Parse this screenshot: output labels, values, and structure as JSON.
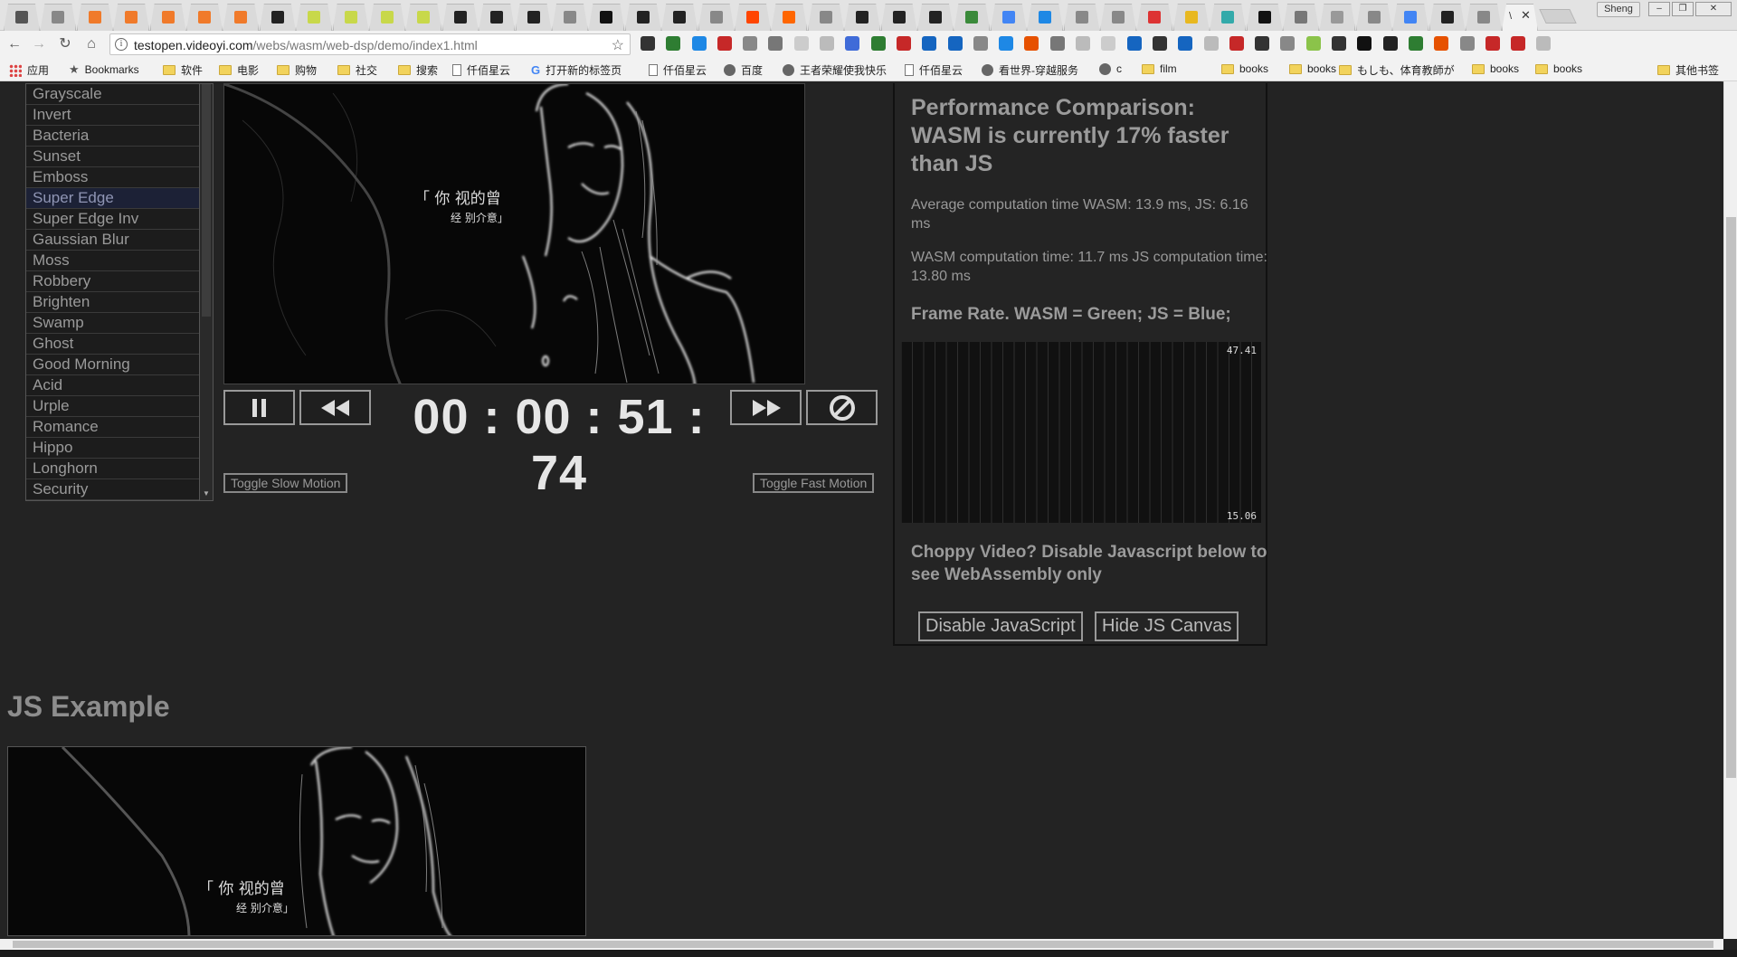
{
  "browser": {
    "profile_name": "Sheng",
    "active_tab_title": "\\",
    "tab_close": "✕",
    "url_host": "testopen.videoyi.com",
    "url_path": "/webs/wasm/web-dsp/demo/index1.html",
    "tab_favicon_colors": [
      "#555",
      "#888",
      "#f07a2a",
      "#f07a2a",
      "#f07a2a",
      "#f07a2a",
      "#f07a2a",
      "#222",
      "#c8d84a",
      "#c8d84a",
      "#c8d84a",
      "#c8d84a",
      "#222",
      "#222",
      "#222",
      "#888",
      "#111",
      "#222",
      "#222",
      "#888",
      "#ff4500",
      "#f60",
      "#888",
      "#222",
      "#222",
      "#222",
      "#3a8a3a",
      "#4285f4",
      "#1e88e5",
      "#888",
      "#888",
      "#d33",
      "#e8b820",
      "#3aa",
      "#111",
      "#777",
      "#999",
      "#888",
      "#4285f4",
      "#222",
      "#888"
    ],
    "ext_icon_colors": [
      "#333",
      "#2e7d32",
      "#1e88e5",
      "#c62828",
      "#888",
      "#777",
      "#ccc",
      "#bbb",
      "#3f6bd8",
      "#2e7d32",
      "#c62828",
      "#1565c0",
      "#1565c0",
      "#888",
      "#1e88e5",
      "#e65100",
      "#777",
      "#bbb",
      "#ccc",
      "#1565c0",
      "#333",
      "#1565c0",
      "#bbb",
      "#c62828",
      "#333",
      "#888",
      "#8bc34a",
      "#333",
      "#111",
      "#222",
      "#2e7d32",
      "#e65100",
      "#888",
      "#c62828",
      "#c62828",
      "#bbb"
    ]
  },
  "bookmarks": [
    {
      "label": "应用",
      "icon": "apps-grid-icon"
    },
    {
      "label": "Bookmarks",
      "icon": "star-icon"
    },
    {
      "label": "软件",
      "icon": "folder-icon"
    },
    {
      "label": "电影",
      "icon": "folder-icon"
    },
    {
      "label": "购物",
      "icon": "folder-icon"
    },
    {
      "label": "社交",
      "icon": "folder-icon"
    },
    {
      "label": "搜索",
      "icon": "folder-icon"
    },
    {
      "label": "仟佰星云",
      "icon": "page-icon"
    },
    {
      "label": "打开新的标签页",
      "icon": "google-icon"
    },
    {
      "label": "仟佰星云",
      "icon": "page-icon"
    },
    {
      "label": "百度",
      "icon": "round-icon"
    },
    {
      "label": "王者荣耀使我快乐",
      "icon": "round-icon"
    },
    {
      "label": "仟佰星云",
      "icon": "page-icon"
    },
    {
      "label": "看世界-穿越服务",
      "icon": "round-icon"
    },
    {
      "label": "c",
      "icon": "round-icon"
    },
    {
      "label": "film",
      "icon": "folder-icon"
    },
    {
      "label": "books",
      "icon": "folder-icon"
    },
    {
      "label": "books",
      "icon": "folder-icon"
    },
    {
      "label": "もしも、体育教師が",
      "icon": "folder-icon"
    },
    {
      "label": "books",
      "icon": "folder-icon"
    },
    {
      "label": "books",
      "icon": "folder-icon"
    },
    {
      "label": "其他书签",
      "icon": "folder-icon"
    }
  ],
  "filters": {
    "selected": "Super Edge",
    "items": [
      "Grayscale",
      "Invert",
      "Bacteria",
      "Sunset",
      "Emboss",
      "Super Edge",
      "Super Edge Inv",
      "Gaussian Blur",
      "Moss",
      "Robbery",
      "Brighten",
      "Swamp",
      "Ghost",
      "Good Morning",
      "Acid",
      "Urple",
      "Romance",
      "Hippo",
      "Longhorn",
      "Security"
    ]
  },
  "player": {
    "timer": "00 : 00 : 51 : 74",
    "pause_icon": "pause-icon",
    "rewind_icon": "rewind-icon",
    "forward_icon": "fast-forward-icon",
    "stop_icon": "no-filter-icon",
    "slow_motion_label": "Toggle Slow Motion",
    "fast_motion_label": "Toggle Fast Motion",
    "subtitle_line1": "「 你  视的曾",
    "subtitle_line2": "经 别介意」"
  },
  "performance": {
    "title": "Performance Comparison: WASM is currently 17% faster than JS",
    "average_line": "Average computation time WASM: 13.9 ms, JS: 6.16 ms",
    "current_line": "WASM computation time: 11.7 ms JS computation time: 13.80 ms",
    "frame_rate_heading": "Frame Rate. WASM = Green; JS = Blue;",
    "choppy_heading": "Choppy Video? Disable Javascript below to see WebAssembly only",
    "disable_js_label": "Disable JavaScript",
    "hide_js_canvas_label": "Hide JS Canvas"
  },
  "chart_data": {
    "type": "line",
    "max_label": "47.41",
    "min_label": "15.06",
    "ylim": [
      15.06,
      47.41
    ],
    "grid": true,
    "series": [
      {
        "name": "WASM",
        "color": "#3cbf3c",
        "values": []
      },
      {
        "name": "JS",
        "color": "#3c6cbf",
        "values": []
      }
    ]
  },
  "js_example": {
    "title": "JS Example"
  }
}
